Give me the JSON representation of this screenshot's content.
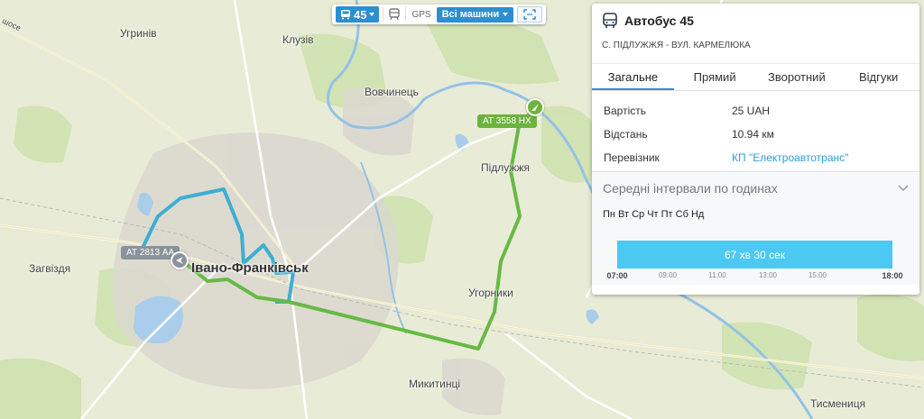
{
  "map": {
    "places": [
      {
        "id": "uhryniv",
        "name": "Угринів"
      },
      {
        "id": "kluziv",
        "name": "Клузів"
      },
      {
        "id": "vovchynets",
        "name": "Вовчинець"
      },
      {
        "id": "pidluzhzhia",
        "name": "Підлужжя"
      },
      {
        "id": "zahvizdia",
        "name": "Загвіздя"
      },
      {
        "id": "ivano-frankivsk",
        "name": "Івано-Франківськ"
      },
      {
        "id": "uhornyky",
        "name": "Угорники"
      },
      {
        "id": "mykytyntsi",
        "name": "Микитинці"
      },
      {
        "id": "tysmenytsia",
        "name": "Тисмениця"
      },
      {
        "id": "shose",
        "name": "шосе"
      }
    ],
    "vehicles": [
      {
        "plate": "АТ 3558 НХ",
        "color": "#6db33f"
      },
      {
        "plate": "АТ 2813 АА",
        "color": "#8a939b"
      }
    ],
    "colors": {
      "route_forward": "#67b946",
      "route_backward": "#3eaed3"
    }
  },
  "toolbar": {
    "route_number": "45",
    "gps_label": "GPS",
    "vehicles_select": "Всі машини",
    "icons": [
      "bus-icon",
      "chevron-down-icon",
      "bus-stop-icon",
      "expand-icon"
    ]
  },
  "panel": {
    "title": "Автобус 45",
    "subtitle": "С. ПІДЛУЖЖЯ - ВУЛ. КАРМЕЛЮКА",
    "tabs": [
      "Загальне",
      "Прямий",
      "Зворотний",
      "Відгуки"
    ],
    "active_tab": "Загальне",
    "info": [
      {
        "label": "Вартість",
        "value": "25 UAH"
      },
      {
        "label": "Відстань",
        "value": "10.94 км"
      },
      {
        "label": "Перевізник",
        "value": "КП \"Електроавтотранс\""
      }
    ],
    "intervals": {
      "title": "Середні інтервали по годинах",
      "days": "Пн Вт Ср Чт Пт Сб Нд",
      "bar_label": "67 хв 30 сек",
      "start": "07:00",
      "end": "18:00",
      "ticks": [
        "07:00",
        "09:00",
        "11:00",
        "13:00",
        "15:00",
        "18:00"
      ]
    },
    "accent_color": "#2c8fd0",
    "link_color": "#2c9fd6"
  }
}
